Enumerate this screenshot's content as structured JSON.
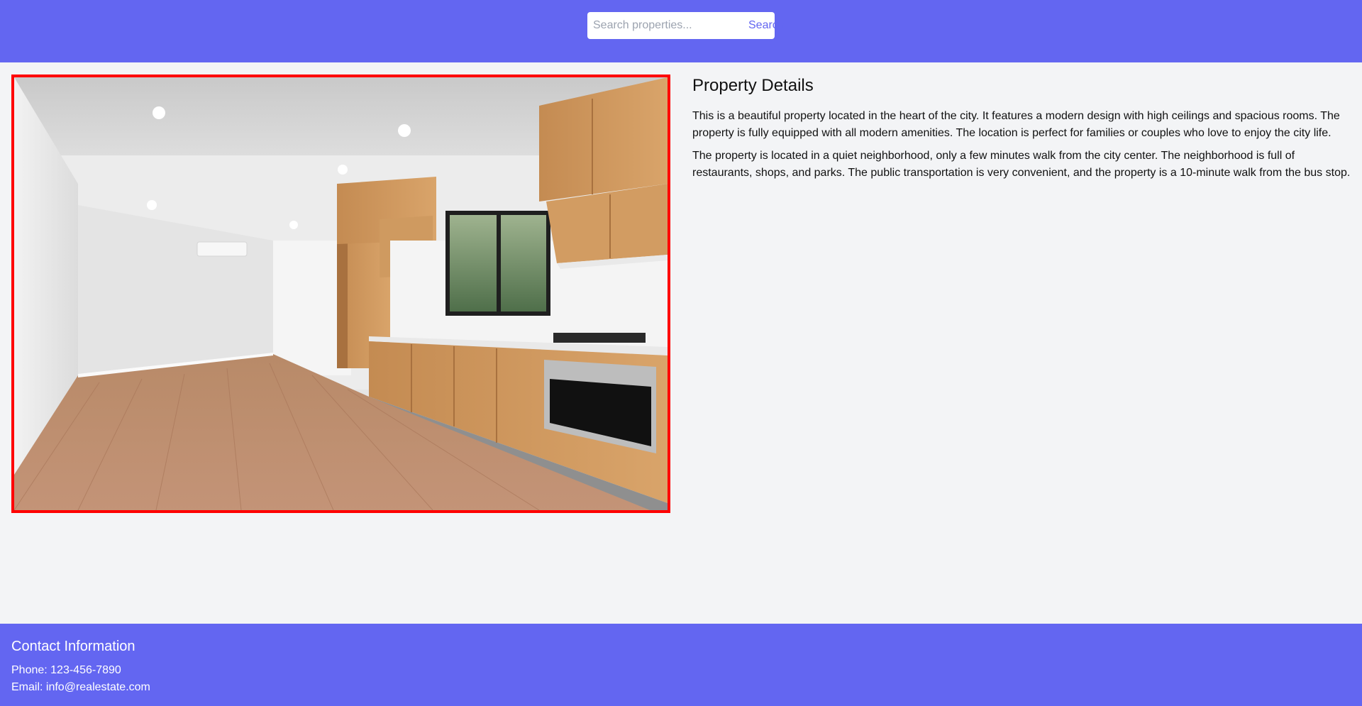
{
  "search": {
    "placeholder": "Search properties...",
    "value": "",
    "button_label": "Search"
  },
  "photo": {
    "subject": "empty modern kitchen and living room with wooden floor",
    "border_color": "#ff0000"
  },
  "details": {
    "title": "Property Details",
    "paragraphs": [
      "This is a beautiful property located in the heart of the city. It features a modern design with high ceilings and spacious rooms. The property is fully equipped with all modern amenities. The location is perfect for families or couples who love to enjoy the city life.",
      "The property is located in a quiet neighborhood, only a few minutes walk from the city center. The neighborhood is full of restaurants, shops, and parks. The public transportation is very convenient, and the property is a 10-minute walk from the bus stop."
    ]
  },
  "footer": {
    "title": "Contact Information",
    "phone": "Phone: 123-456-7890",
    "email": "Email: info@realestate.com"
  },
  "colors": {
    "brand": "#6366f1",
    "page_background": "#f3f4f6",
    "accent_text": "#6366f1"
  }
}
